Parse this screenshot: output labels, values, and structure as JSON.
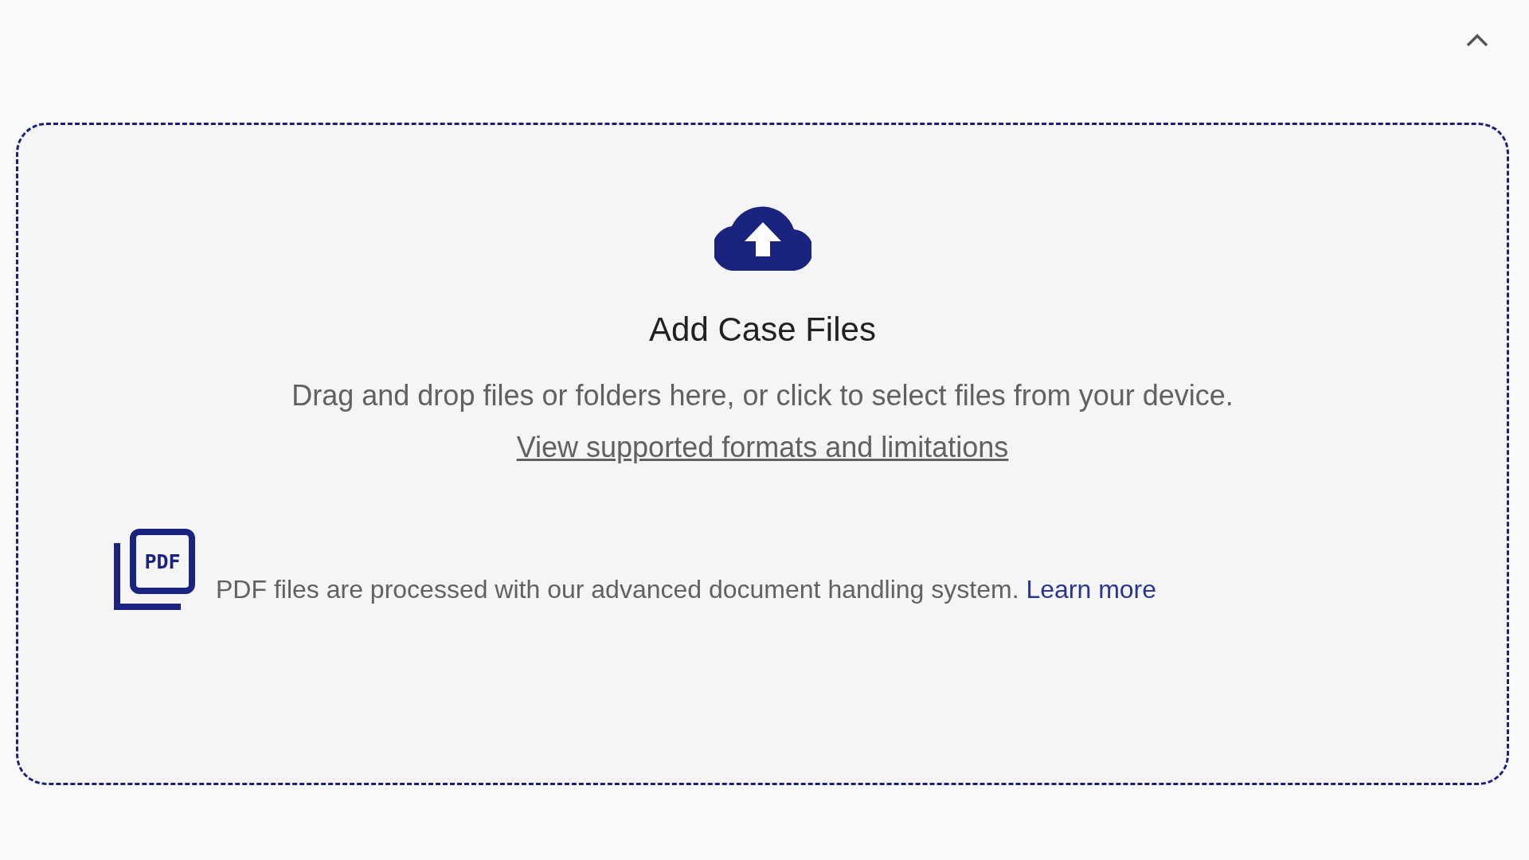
{
  "panel": {
    "expanded": true
  },
  "dropzone": {
    "title": "Add Case Files",
    "description": "Drag and drop files or folders here, or click to select files from your device.",
    "link": "View supported formats and limitations"
  },
  "pdf_notice": {
    "icon_label": "PDF",
    "text": "PDF files are processed with our advanced document handling system.",
    "link": "Learn more"
  }
}
